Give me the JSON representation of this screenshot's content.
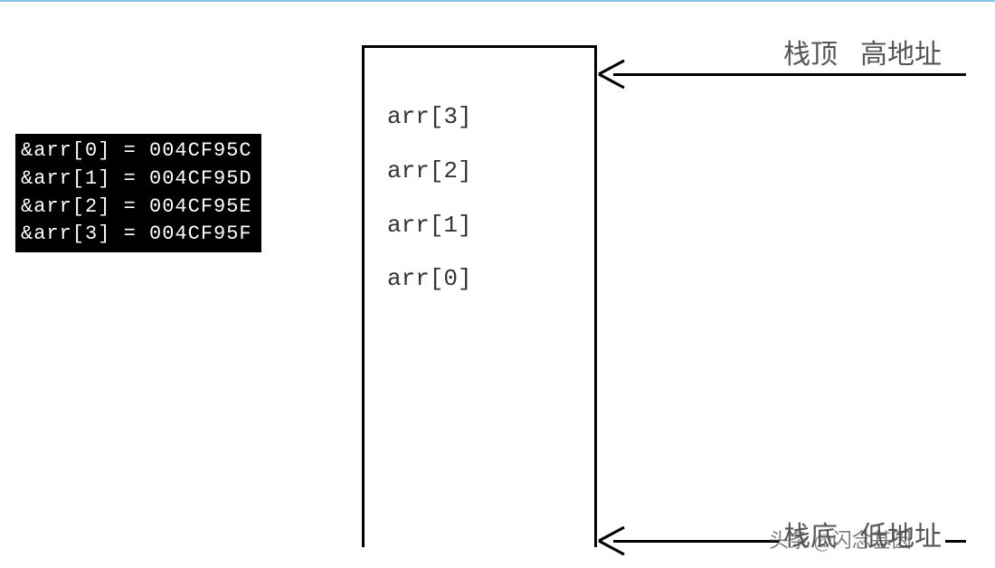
{
  "terminal": {
    "rows": [
      "&arr[0] = 004CF95C",
      "&arr[1] = 004CF95D",
      "&arr[2] = 004CF95E",
      "&arr[3] = 004CF95F"
    ]
  },
  "stack": {
    "items": [
      "arr[3]",
      "arr[2]",
      "arr[1]",
      "arr[0]"
    ]
  },
  "labels": {
    "top_left": "栈顶",
    "top_right": "高地址",
    "bottom_left": "栈底",
    "bottom_right": "低地址"
  },
  "watermark": "头条 @闪念基因"
}
